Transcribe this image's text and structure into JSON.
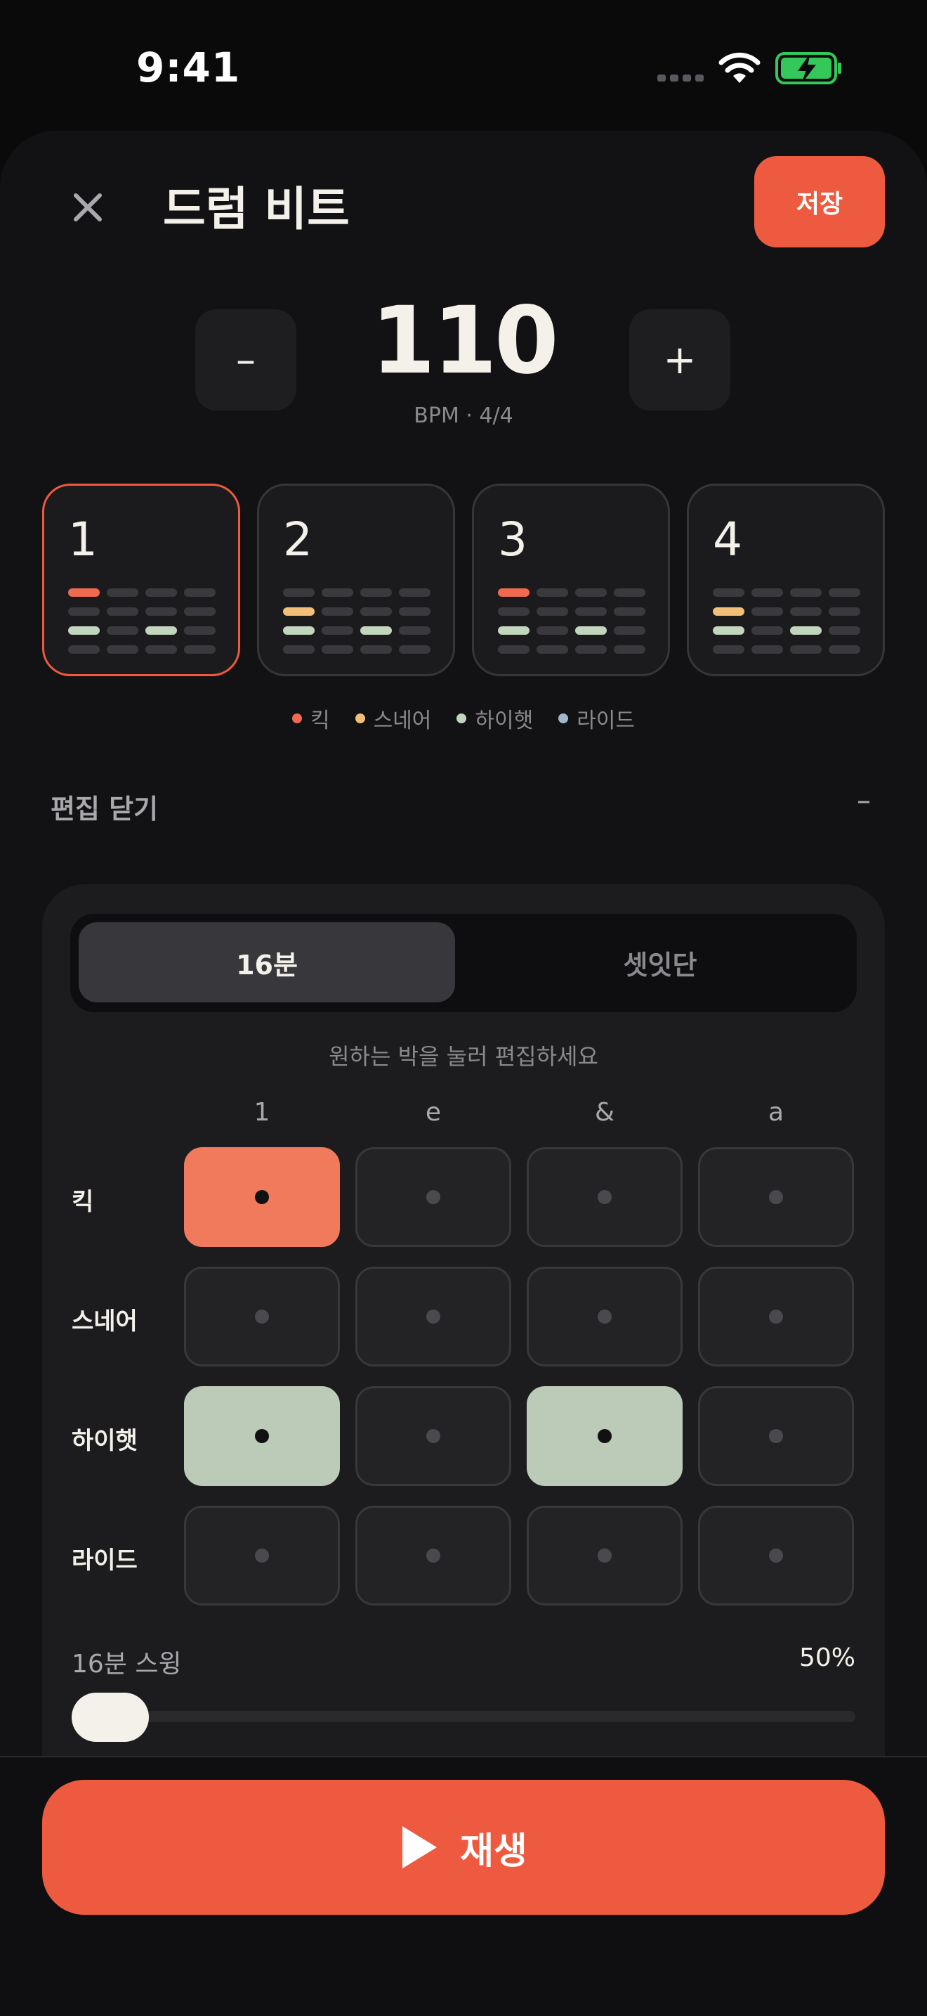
{
  "status": {
    "time": "9:41"
  },
  "header": {
    "title": "드럼 비트",
    "save_label": "저장",
    "close_icon": "close-icon"
  },
  "tempo": {
    "bpm": "110",
    "sub": "BPM · 4/4",
    "minus_label": "–",
    "plus_label": "+"
  },
  "patterns": [
    {
      "number": "1",
      "active": true
    },
    {
      "number": "2",
      "active": false
    },
    {
      "number": "3",
      "active": false
    },
    {
      "number": "4",
      "active": false
    }
  ],
  "legend": [
    {
      "label": "킥",
      "color": "#ef6a4e"
    },
    {
      "label": "스네어",
      "color": "#f1bf78"
    },
    {
      "label": "하이햇",
      "color": "#c2d5bd"
    },
    {
      "label": "라이드",
      "color": "#9fb8cf"
    }
  ],
  "edit": {
    "label": "편집 닫기",
    "toggle": "–"
  },
  "editor": {
    "subdivisions": [
      "16분",
      "셋잇단"
    ],
    "selected_subdivision": "16분",
    "hint": "원하는 박을 눌러 편집하세요",
    "columns": [
      "1",
      "e",
      "&",
      "a"
    ],
    "rows": [
      {
        "label": "킥",
        "steps": [
          true,
          false,
          false,
          false
        ]
      },
      {
        "label": "스네어",
        "steps": [
          false,
          false,
          false,
          false
        ]
      },
      {
        "label": "하이햇",
        "steps": [
          true,
          false,
          true,
          false
        ]
      },
      {
        "label": "라이드",
        "steps": [
          false,
          false,
          false,
          false
        ]
      }
    ],
    "swing_label": "16분 스윙",
    "swing_value": "50%",
    "swing_level": 0
  },
  "play": {
    "label": "재생"
  },
  "colors": {
    "accent": "#ee5a3f",
    "kick": "#f27a5c",
    "hat": "#bccbb7"
  }
}
